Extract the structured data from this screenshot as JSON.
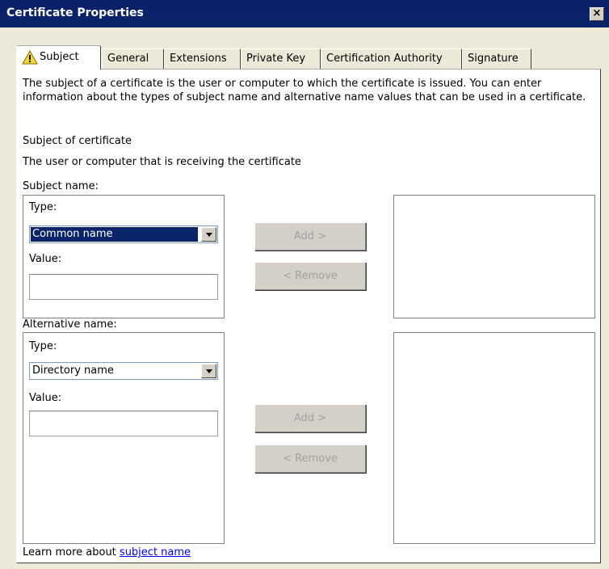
{
  "window": {
    "title": "Certificate Properties",
    "close_label": "×"
  },
  "tabs": [
    {
      "label": "Subject"
    },
    {
      "label": "General"
    },
    {
      "label": "Extensions"
    },
    {
      "label": "Private Key"
    },
    {
      "label": "Certification Authority"
    },
    {
      "label": "Signature"
    }
  ],
  "description": "The subject of a certificate is the user or computer to which the certificate is issued. You can enter information about the types of subject name and alternative name values that can be used in a certificate.",
  "subject_of_certificate": "Subject of certificate",
  "subject_explanation": "The user or computer that is receiving the certificate",
  "subject_name": {
    "heading": "Subject name:",
    "type_label": "Type:",
    "type_value": "Common name",
    "value_label": "Value:",
    "value": "",
    "add_button": "Add >",
    "remove_button": "< Remove"
  },
  "alternative_name": {
    "heading": "Alternative name:",
    "type_label": "Type:",
    "type_value": "Directory name",
    "value_label": "Value:",
    "value": "",
    "add_button": "Add >",
    "remove_button": "< Remove"
  },
  "footer": {
    "prefix": "Learn more about ",
    "link": "subject name"
  },
  "icons": {
    "tab_warning": "warning-icon",
    "dropdown": "chevron-down-icon"
  },
  "colors": {
    "titlebar": "#0a2569",
    "selection": "#0a246a",
    "link": "#0000ee"
  }
}
